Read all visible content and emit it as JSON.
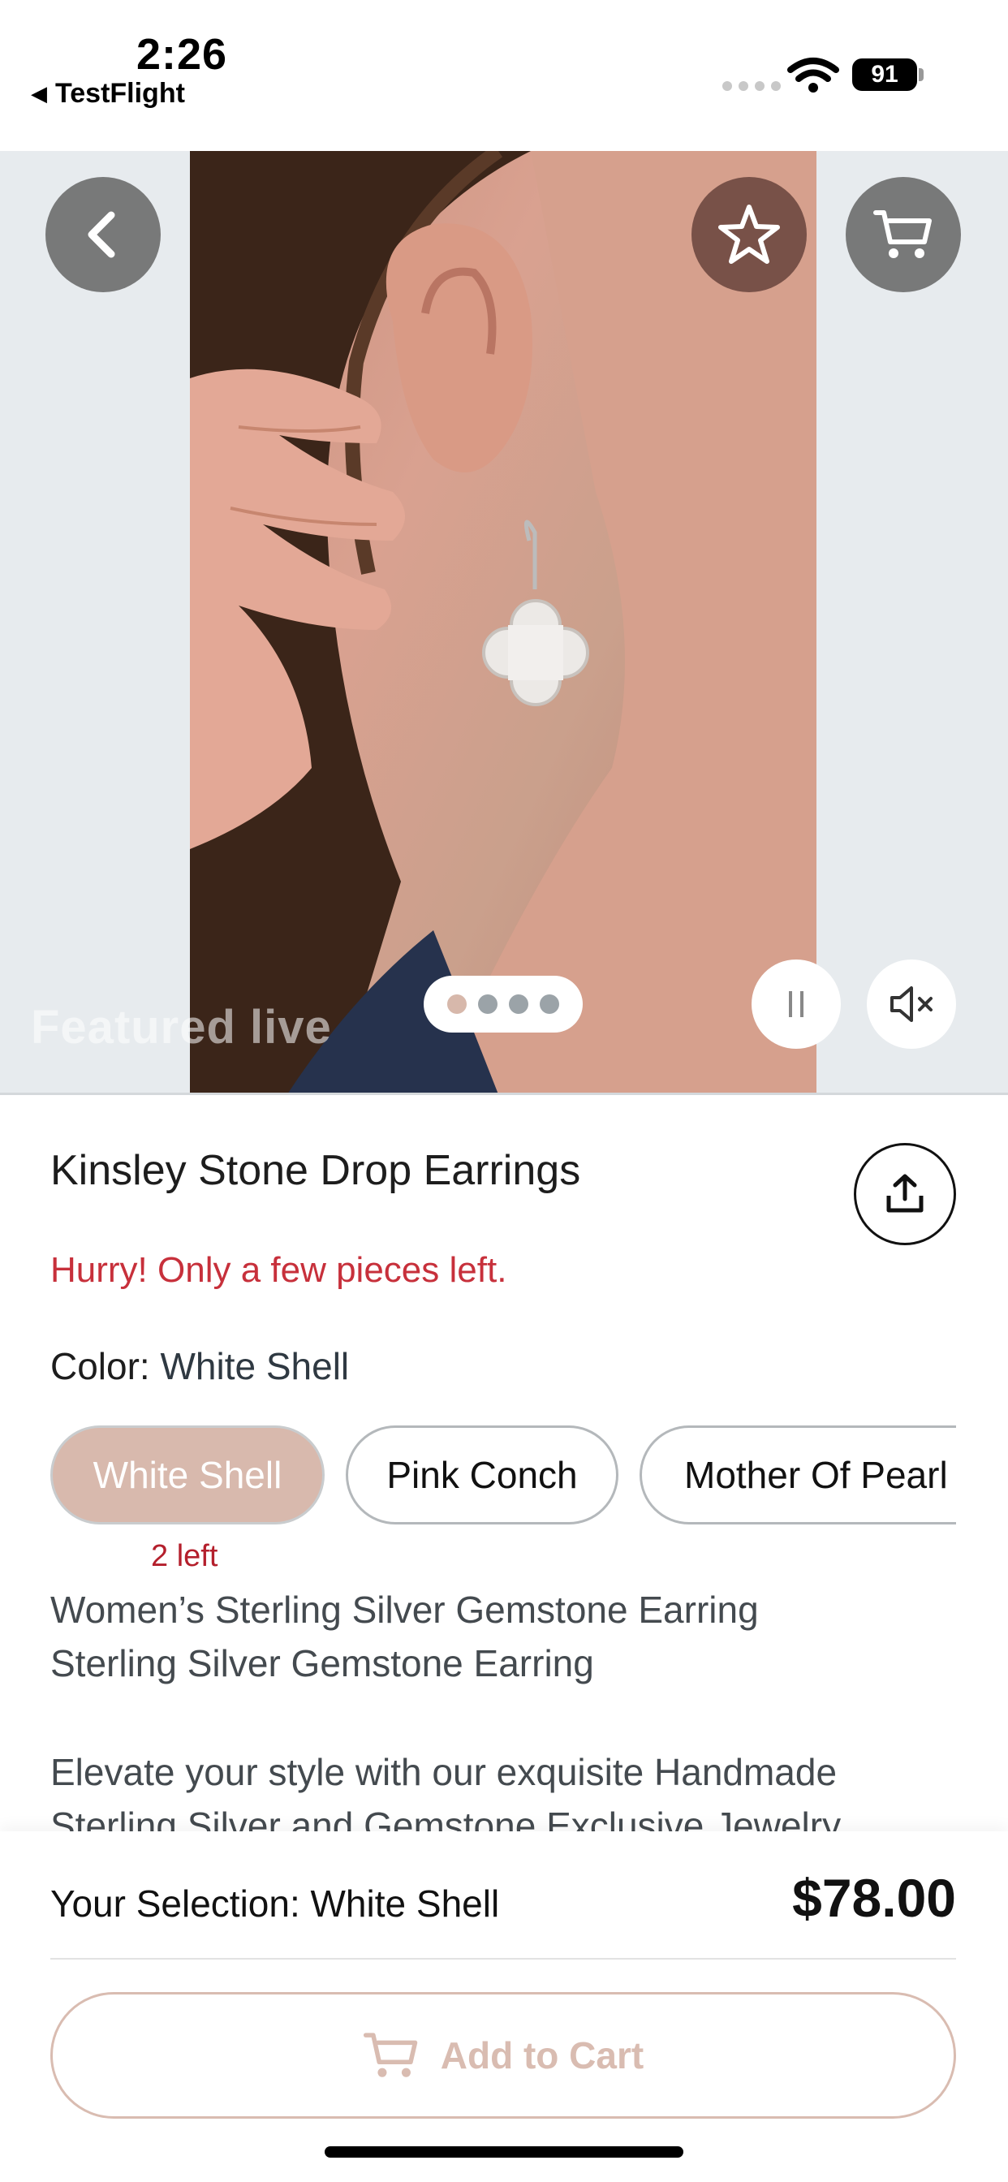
{
  "status_bar": {
    "time": "2:26",
    "back_app": "TestFlight",
    "battery": "91"
  },
  "media": {
    "featured_label": "Featured live",
    "page_count": 4,
    "active_page": 1,
    "icons": {
      "back": "chevron-left-icon",
      "favorite": "star-icon",
      "cart": "cart-icon",
      "pause": "pause-icon",
      "mute": "speaker-muted-icon"
    }
  },
  "product": {
    "title": "Kinsley Stone Drop Earrings",
    "urgency": "Hurry! Only a few pieces left.",
    "color_label": "Color:",
    "color_value": "White Shell",
    "options": [
      {
        "label": "White Shell",
        "selected": true
      },
      {
        "label": "Pink Conch",
        "selected": false
      },
      {
        "label": "Mother Of Pearl",
        "selected": false
      }
    ],
    "stock_note": "2 left",
    "subtitle_1": "Women’s Sterling Silver Gemstone Earring",
    "subtitle_2": "Sterling Silver Gemstone Earring",
    "description_1": "Elevate your style with our exquisite Handmade",
    "description_2": "Sterling Silver and Gemstone Exclusive Jewelry"
  },
  "purchase": {
    "selection_text": "Your Selection: White Shell",
    "price": "$78.00",
    "add_to_cart": "Add to Cart"
  },
  "colors": {
    "accent": "#d8b9ad",
    "urgency_red": "#c7303b"
  }
}
